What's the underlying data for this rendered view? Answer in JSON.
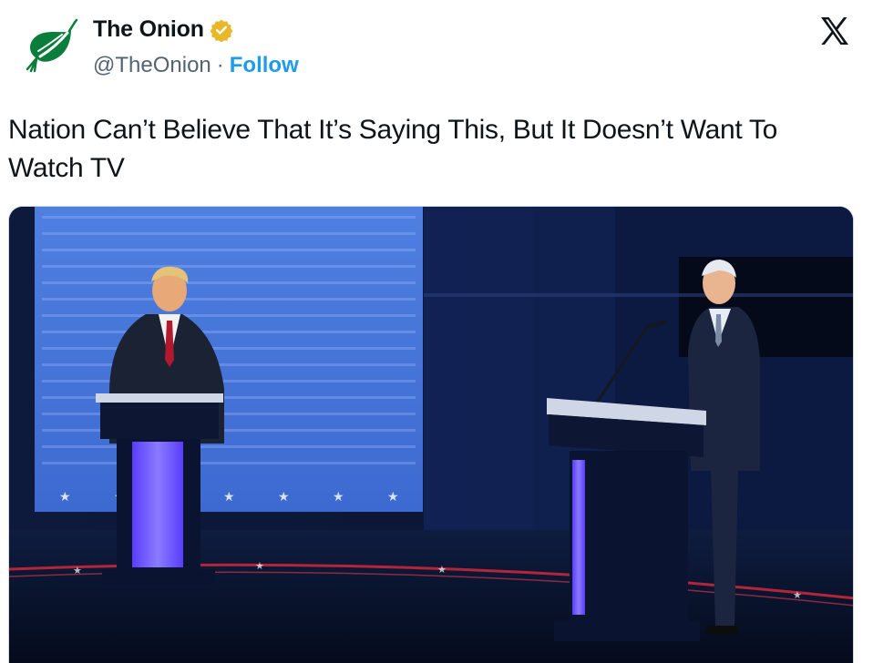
{
  "account": {
    "display_name": "The Onion",
    "handle": "@TheOnion",
    "separator": "·",
    "follow_label": "Follow",
    "verified_color": "#e8b829"
  },
  "post": {
    "text": "Nation Can’t Believe That It’s Saying This, But It Doesn’t Want To Watch TV"
  },
  "media": {
    "type": "photo"
  },
  "icons": {
    "brand_logo": "x-logo-icon",
    "avatar_logo": "onion-logo-icon",
    "verified": "verified-badge-icon"
  },
  "colors": {
    "link_blue": "#1d9bf0",
    "onion_green": "#0b7d3a",
    "text": "#0f1419",
    "secondary": "#536471"
  }
}
